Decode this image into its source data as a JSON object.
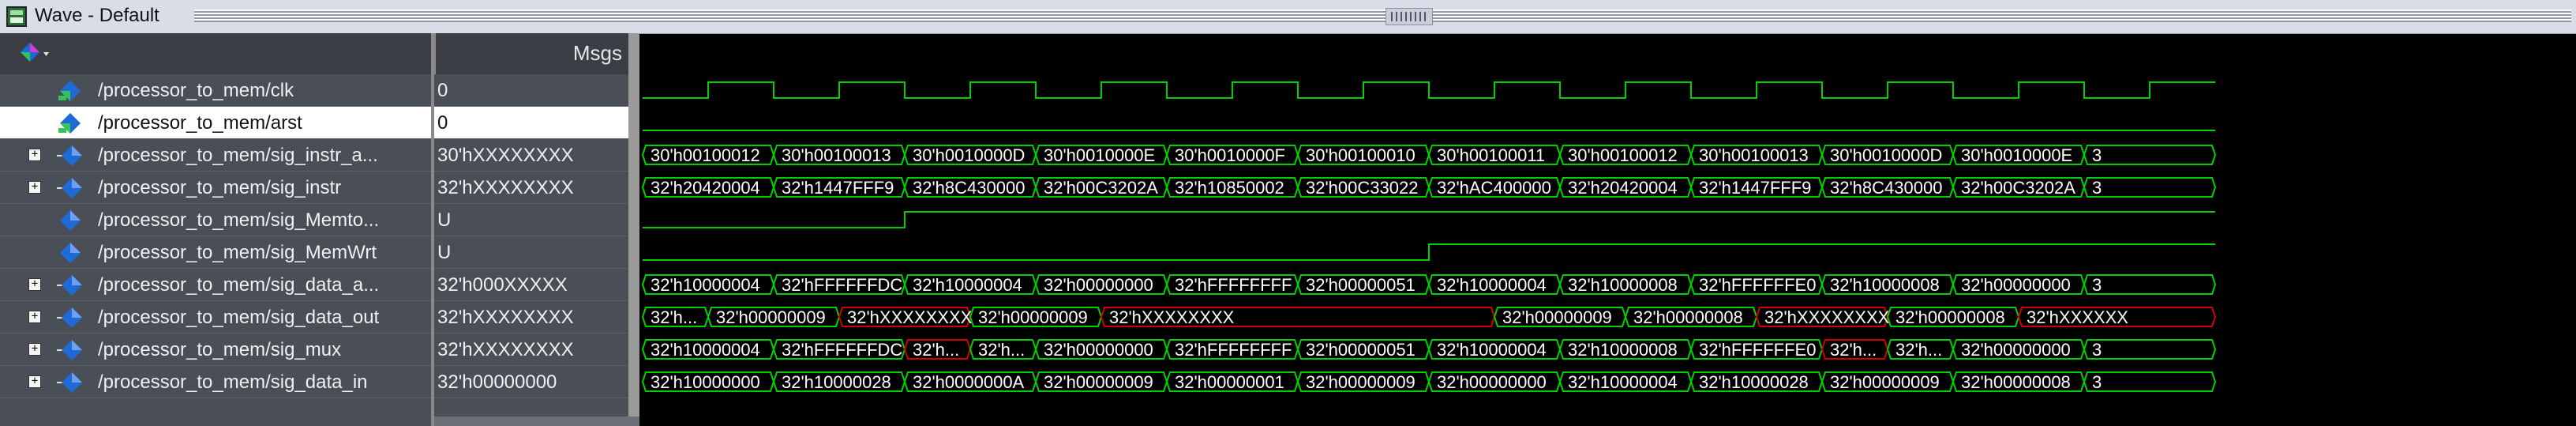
{
  "window": {
    "title": "Wave - Default"
  },
  "header": {
    "messages_label": "Msgs",
    "toolbar_icon": "diamond-dropdown-icon"
  },
  "colors": {
    "waveform": "#00d000",
    "unknown": "#d00000",
    "text": "#ffffff"
  },
  "signals": [
    {
      "name": "/processor_to_mem/clk",
      "value": "0",
      "expandable": false,
      "icon": "clock-signal-icon"
    },
    {
      "name": "/processor_to_mem/arst",
      "value": "0",
      "expandable": false,
      "icon": "signal-icon",
      "selected": true
    },
    {
      "name": "/processor_to_mem/sig_instr_a...",
      "value": "30'hXXXXXXXX",
      "expandable": true,
      "icon": "bus-icon"
    },
    {
      "name": "/processor_to_mem/sig_instr",
      "value": "32'hXXXXXXXX",
      "expandable": true,
      "icon": "bus-icon"
    },
    {
      "name": "/processor_to_mem/sig_Memto...",
      "value": "U",
      "expandable": false,
      "icon": "signal-icon"
    },
    {
      "name": "/processor_to_mem/sig_MemWrt",
      "value": "U",
      "expandable": false,
      "icon": "signal-icon"
    },
    {
      "name": "/processor_to_mem/sig_data_a...",
      "value": "32'h000XXXXX",
      "expandable": true,
      "icon": "bus-icon"
    },
    {
      "name": "/processor_to_mem/sig_data_out",
      "value": "32'hXXXXXXXX",
      "expandable": true,
      "icon": "bus-icon"
    },
    {
      "name": "/processor_to_mem/sig_mux",
      "value": "32'hXXXXXXXX",
      "expandable": true,
      "icon": "bus-icon"
    },
    {
      "name": "/processor_to_mem/sig_data_in",
      "value": "32'h00000000",
      "expandable": true,
      "icon": "bus-icon"
    }
  ],
  "waves": {
    "sig_instr_a": [
      {
        "s": 0,
        "e": 2,
        "v": "30'h00100012"
      },
      {
        "s": 2,
        "e": 4,
        "v": "30'h00100013"
      },
      {
        "s": 4,
        "e": 6,
        "v": "30'h0010000D"
      },
      {
        "s": 6,
        "e": 8,
        "v": "30'h0010000E"
      },
      {
        "s": 8,
        "e": 10,
        "v": "30'h0010000F"
      },
      {
        "s": 10,
        "e": 12,
        "v": "30'h00100010"
      },
      {
        "s": 12,
        "e": 14,
        "v": "30'h00100011"
      },
      {
        "s": 14,
        "e": 16,
        "v": "30'h00100012"
      },
      {
        "s": 16,
        "e": 18,
        "v": "30'h00100013"
      },
      {
        "s": 18,
        "e": 20,
        "v": "30'h0010000D"
      },
      {
        "s": 20,
        "e": 22,
        "v": "30'h0010000E"
      },
      {
        "s": 22,
        "e": 24,
        "v": "3"
      }
    ],
    "sig_instr": [
      {
        "s": 0,
        "e": 2,
        "v": "32'h20420004"
      },
      {
        "s": 2,
        "e": 4,
        "v": "32'h1447FFF9"
      },
      {
        "s": 4,
        "e": 6,
        "v": "32'h8C430000"
      },
      {
        "s": 6,
        "e": 8,
        "v": "32'h00C3202A"
      },
      {
        "s": 8,
        "e": 10,
        "v": "32'h10850002"
      },
      {
        "s": 10,
        "e": 12,
        "v": "32'h00C33022"
      },
      {
        "s": 12,
        "e": 14,
        "v": "32'hAC400000"
      },
      {
        "s": 14,
        "e": 16,
        "v": "32'h20420004"
      },
      {
        "s": 16,
        "e": 18,
        "v": "32'h1447FFF9"
      },
      {
        "s": 18,
        "e": 20,
        "v": "32'h8C430000"
      },
      {
        "s": 20,
        "e": 22,
        "v": "32'h00C3202A"
      },
      {
        "s": 22,
        "e": 24,
        "v": "3"
      }
    ],
    "sig_data_a": [
      {
        "s": 0,
        "e": 2,
        "v": "32'h10000004"
      },
      {
        "s": 2,
        "e": 4,
        "v": "32'hFFFFFFDC"
      },
      {
        "s": 4,
        "e": 6,
        "v": "32'h10000004"
      },
      {
        "s": 6,
        "e": 8,
        "v": "32'h00000000"
      },
      {
        "s": 8,
        "e": 10,
        "v": "32'hFFFFFFFF"
      },
      {
        "s": 10,
        "e": 12,
        "v": "32'h00000051"
      },
      {
        "s": 12,
        "e": 14,
        "v": "32'h10000004"
      },
      {
        "s": 14,
        "e": 16,
        "v": "32'h10000008"
      },
      {
        "s": 16,
        "e": 18,
        "v": "32'hFFFFFFE0"
      },
      {
        "s": 18,
        "e": 20,
        "v": "32'h10000008"
      },
      {
        "s": 20,
        "e": 22,
        "v": "32'h00000000"
      },
      {
        "s": 22,
        "e": 24,
        "v": "3"
      }
    ],
    "sig_data_out": [
      {
        "s": 0,
        "e": 1,
        "v": "32'h..."
      },
      {
        "s": 1,
        "e": 3,
        "v": "32'h00000009"
      },
      {
        "s": 3,
        "e": 5,
        "v": "32'hXXXXXXXX",
        "x": true
      },
      {
        "s": 5,
        "e": 7,
        "v": "32'h00000009"
      },
      {
        "s": 7,
        "e": 13,
        "v": "32'hXXXXXXXX",
        "x": true
      },
      {
        "s": 13,
        "e": 15,
        "v": "32'h00000009"
      },
      {
        "s": 15,
        "e": 17,
        "v": "32'h00000008"
      },
      {
        "s": 17,
        "e": 19,
        "v": "32'hXXXXXXXX",
        "x": true
      },
      {
        "s": 19,
        "e": 21,
        "v": "32'h00000008"
      },
      {
        "s": 21,
        "e": 24,
        "v": "32'hXXXXXX",
        "x": true
      }
    ],
    "sig_mux": [
      {
        "s": 0,
        "e": 2,
        "v": "32'h10000004"
      },
      {
        "s": 2,
        "e": 4,
        "v": "32'hFFFFFFDC"
      },
      {
        "s": 4,
        "e": 5,
        "v": "32'h...",
        "x": true
      },
      {
        "s": 5,
        "e": 6,
        "v": "32'h..."
      },
      {
        "s": 6,
        "e": 8,
        "v": "32'h00000000"
      },
      {
        "s": 8,
        "e": 10,
        "v": "32'hFFFFFFFF"
      },
      {
        "s": 10,
        "e": 12,
        "v": "32'h00000051"
      },
      {
        "s": 12,
        "e": 14,
        "v": "32'h10000004"
      },
      {
        "s": 14,
        "e": 16,
        "v": "32'h10000008"
      },
      {
        "s": 16,
        "e": 18,
        "v": "32'hFFFFFFE0"
      },
      {
        "s": 18,
        "e": 19,
        "v": "32'h...",
        "x": true
      },
      {
        "s": 19,
        "e": 20,
        "v": "32'h..."
      },
      {
        "s": 20,
        "e": 22,
        "v": "32'h00000000"
      },
      {
        "s": 22,
        "e": 24,
        "v": "3"
      }
    ],
    "sig_data_in": [
      {
        "s": 0,
        "e": 2,
        "v": "32'h10000000"
      },
      {
        "s": 2,
        "e": 4,
        "v": "32'h10000028"
      },
      {
        "s": 4,
        "e": 6,
        "v": "32'h0000000A"
      },
      {
        "s": 6,
        "e": 8,
        "v": "32'h00000009"
      },
      {
        "s": 8,
        "e": 10,
        "v": "32'h00000001"
      },
      {
        "s": 10,
        "e": 12,
        "v": "32'h00000009"
      },
      {
        "s": 12,
        "e": 14,
        "v": "32'h00000000"
      },
      {
        "s": 14,
        "e": 16,
        "v": "32'h10000004"
      },
      {
        "s": 16,
        "e": 18,
        "v": "32'h10000028"
      },
      {
        "s": 18,
        "e": 20,
        "v": "32'h00000009"
      },
      {
        "s": 20,
        "e": 22,
        "v": "32'h00000008"
      },
      {
        "s": 22,
        "e": 24,
        "v": "3"
      }
    ]
  },
  "bits": {
    "clk": [
      0,
      1,
      0,
      1,
      0,
      1,
      0,
      1,
      0,
      1,
      0,
      1,
      0,
      1,
      0,
      1,
      0,
      1,
      0,
      1,
      0,
      1,
      0,
      1
    ],
    "arst": [
      0,
      0,
      0,
      0,
      0,
      0,
      0,
      0,
      0,
      0,
      0,
      0,
      0,
      0,
      0,
      0,
      0,
      0,
      0,
      0,
      0,
      0,
      0,
      0
    ],
    "sig_Memto": [
      0,
      0,
      0,
      0,
      1,
      1,
      1,
      1,
      1,
      1,
      1,
      1,
      1,
      1,
      1,
      1,
      1,
      1,
      1,
      1,
      1,
      1,
      1,
      1
    ],
    "sig_MemWrt": [
      0,
      0,
      0,
      0,
      0,
      0,
      0,
      0,
      0,
      0,
      0,
      0,
      1,
      1,
      1,
      1,
      1,
      1,
      1,
      1,
      1,
      1,
      1,
      1
    ]
  }
}
